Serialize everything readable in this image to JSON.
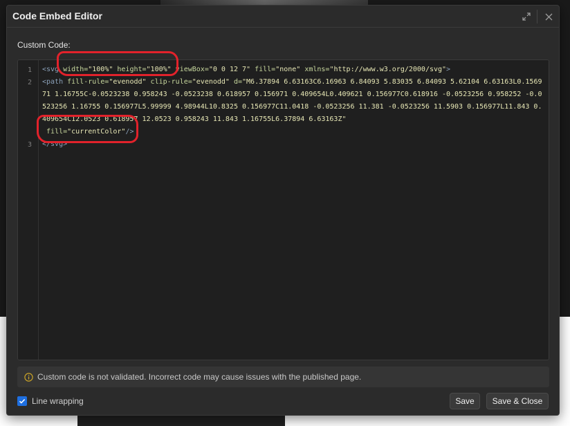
{
  "modal": {
    "title": "Code Embed Editor",
    "expand_icon": "expand-icon",
    "close_icon": "close-icon"
  },
  "editor": {
    "label": "Custom Code:",
    "line_numbers": [
      "1",
      "2",
      "3"
    ],
    "line1": {
      "open": "<svg ",
      "a1": "width=",
      "v1": "\"100%\"",
      "a2": " height=",
      "v2": "\"100%\"",
      "a3": " viewBox=",
      "v3": "\"0 0 12 7\"",
      "a4": " fill=",
      "v4": "\"none\"",
      "a5": " xmlns=",
      "v5": "\"http://www.w3.org/2000/svg\"",
      "close": ">"
    },
    "line2": {
      "open": "<path ",
      "a1": "fill-rule=",
      "v1": "\"evenodd\"",
      "a2": " clip-rule=",
      "v2": "\"evenodd\"",
      "a3": " d=",
      "v3": "\"M6.37894 6.63163C6.16963 6.84093 5.83035 6.84093 5.62104 6.63163L0.156971 1.16755C-0.0523238 0.958243 -0.0523238 0.618957 0.156971 0.409654L0.409621 0.156977C0.618916 -0.0523256 0.958252 -0.0523256 1.16755 0.156977L5.99999 4.98944L10.8325 0.156977C11.0418 -0.0523256 11.381 -0.0523256 11.5903 0.156977L11.843 0.409654C12.0523 0.618957 12.0523 0.958243 11.843 1.16755L6.37894 6.63163Z\"",
      "a4": " fill=",
      "v4": "\"currentColor\"",
      "close": "/>"
    },
    "line3": "</svg>"
  },
  "notice": {
    "icon": "info-icon",
    "text": "Custom code is not validated. Incorrect code may cause issues with the published page."
  },
  "footer": {
    "line_wrapping_label": "Line wrapping",
    "line_wrapping_checked": true,
    "save_label": "Save",
    "save_close_label": "Save & Close"
  },
  "colors": {
    "accent": "#1e6fe0",
    "annotation": "#e2222b",
    "modal_bg": "#2b2b2b",
    "editor_bg": "#1f1f1f"
  }
}
